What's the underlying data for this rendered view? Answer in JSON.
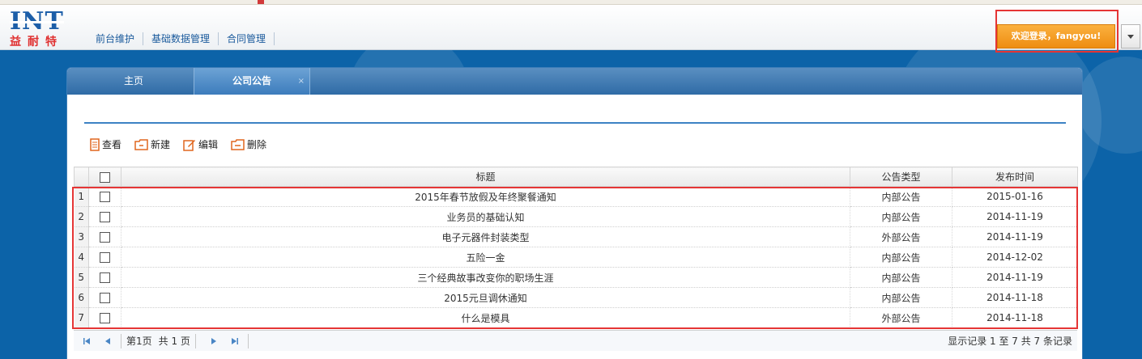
{
  "logo": {
    "mark": "INT",
    "name_cn": "益耐特"
  },
  "nav": {
    "items": [
      "前台维护",
      "基础数据管理",
      "合同管理"
    ]
  },
  "user": {
    "welcome": "欢迎登录，fangyou!"
  },
  "tabs": {
    "home": "主页",
    "active": "公司公告",
    "close_glyph": "×"
  },
  "toolbar": {
    "view": "查看",
    "new": "新建",
    "edit": "编辑",
    "delete": "删除"
  },
  "table": {
    "headers": {
      "title": "标题",
      "type": "公告类型",
      "date": "发布时间"
    },
    "rows": [
      {
        "n": "1",
        "title": "2015年春节放假及年终聚餐通知",
        "type": "内部公告",
        "date": "2015-01-16"
      },
      {
        "n": "2",
        "title": "业务员的基础认知",
        "type": "内部公告",
        "date": "2014-11-19"
      },
      {
        "n": "3",
        "title": "电子元器件封装类型",
        "type": "外部公告",
        "date": "2014-11-19"
      },
      {
        "n": "4",
        "title": "五险一金",
        "type": "内部公告",
        "date": "2014-12-02"
      },
      {
        "n": "5",
        "title": "三个经典故事改变你的职场生涯",
        "type": "内部公告",
        "date": "2014-11-19"
      },
      {
        "n": "6",
        "title": "2015元旦调休通知",
        "type": "内部公告",
        "date": "2014-11-18"
      },
      {
        "n": "7",
        "title": "什么是模具",
        "type": "外部公告",
        "date": "2014-11-18"
      }
    ]
  },
  "pager": {
    "page_label": "第",
    "page": "1",
    "page_unit": "页",
    "total_label": "共 1 页",
    "summary": "显示记录 1 至 7 共 7 条记录"
  },
  "colors": {
    "accent": "#0c63a8",
    "highlight": "#e53535",
    "button": "#f5a02a"
  }
}
